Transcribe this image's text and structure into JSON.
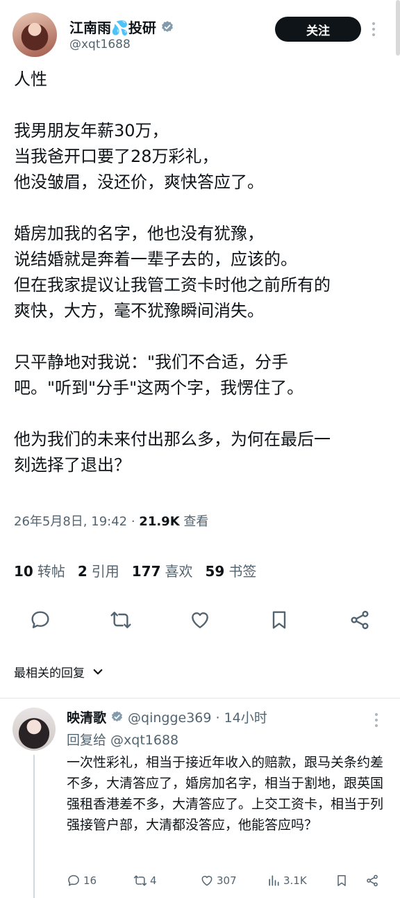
{
  "post": {
    "display_name": "江南雨💦投研",
    "handle": "@xqt1688",
    "follow_label": "关注",
    "paragraphs": [
      "人性",
      "我男朋友年薪30万，\n当我爸开口要了28万彩礼，\n他没皱眉，没还价，爽快答应了。",
      "婚房加我的名字，他也没有犹豫，\n说结婚就是奔着一辈子去的，应该的。\n但在我家提议让我管工资卡时他之前所有的\n爽快，大方，毫不犹豫瞬间消失。",
      "只平静地对我说：\"我们不合适，分手\n吧。\"听到\"分手\"这两个字，我愣住了。",
      "他为我们的未来付出那么多，为何在最后一\n刻选择了退出？"
    ],
    "timestamp": "26年5月8日, 19:42 · ",
    "views_count": "21.9K",
    "views_label": " 查看"
  },
  "stats": {
    "reposts_count": "10",
    "reposts_label": "转帖",
    "quotes_count": "2",
    "quotes_label": "引用",
    "likes_count": "177",
    "likes_label": "喜欢",
    "bookmarks_count": "59",
    "bookmarks_label": "书签"
  },
  "actions": [
    "reply-icon",
    "repost-icon",
    "like-icon",
    "bookmark-icon",
    "share-icon"
  ],
  "sort": {
    "label": "最相关的回复"
  },
  "reply": {
    "display_name": "映清歌",
    "handle_time": "@qingge369 · 14小时",
    "reply_to": "回复给 @xqt1688",
    "text": "一次性彩礼，相当于接近年收入的赔款，跟马关条约差不多，大清答应了，婚房加名字，相当于割地，跟英国强租香港差不多，大清答应了。上交工资卡，相当于列强接管户部，大清都没答应，他能答应吗？",
    "reply_count": "16",
    "repost_count": "4",
    "like_count": "307",
    "view_count": "3.1K"
  },
  "colors": {
    "text": "#0f1419",
    "secondary": "#536471",
    "verified": "#829aab",
    "follow_bg": "#0f1419"
  }
}
